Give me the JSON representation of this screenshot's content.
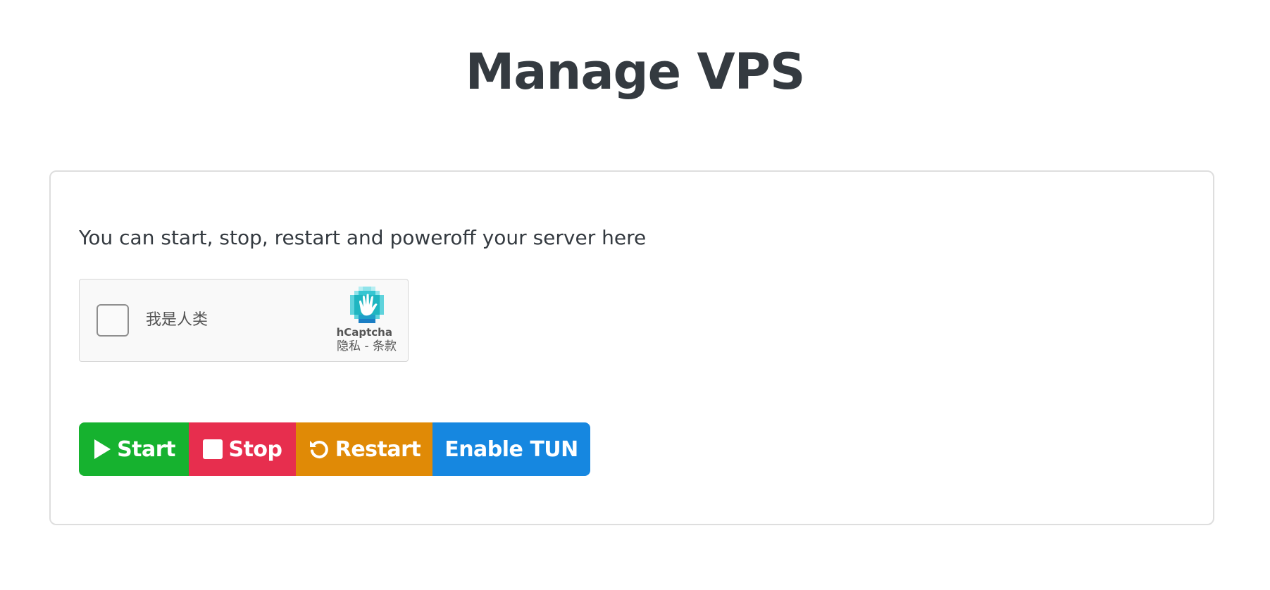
{
  "page": {
    "title": "Manage VPS"
  },
  "card": {
    "intro": "You can start, stop, restart and poweroff your server here",
    "captcha": {
      "label": "我是人类",
      "brand": "hCaptcha",
      "privacy": "隐私",
      "separator": " - ",
      "terms": "条款"
    },
    "buttons": {
      "start": "Start",
      "stop": "Stop",
      "restart": "Restart",
      "tun": "Enable TUN"
    }
  },
  "colors": {
    "start": "#16b22f",
    "stop": "#e72e4e",
    "restart": "#e08a06",
    "tun": "#1687e0",
    "captcha_logo": "#1fb6c1"
  },
  "icons": {
    "start": "play-icon",
    "stop": "stop-square-icon",
    "restart": "rotate-ccw-icon",
    "captcha": "hcaptcha-hand-icon"
  }
}
